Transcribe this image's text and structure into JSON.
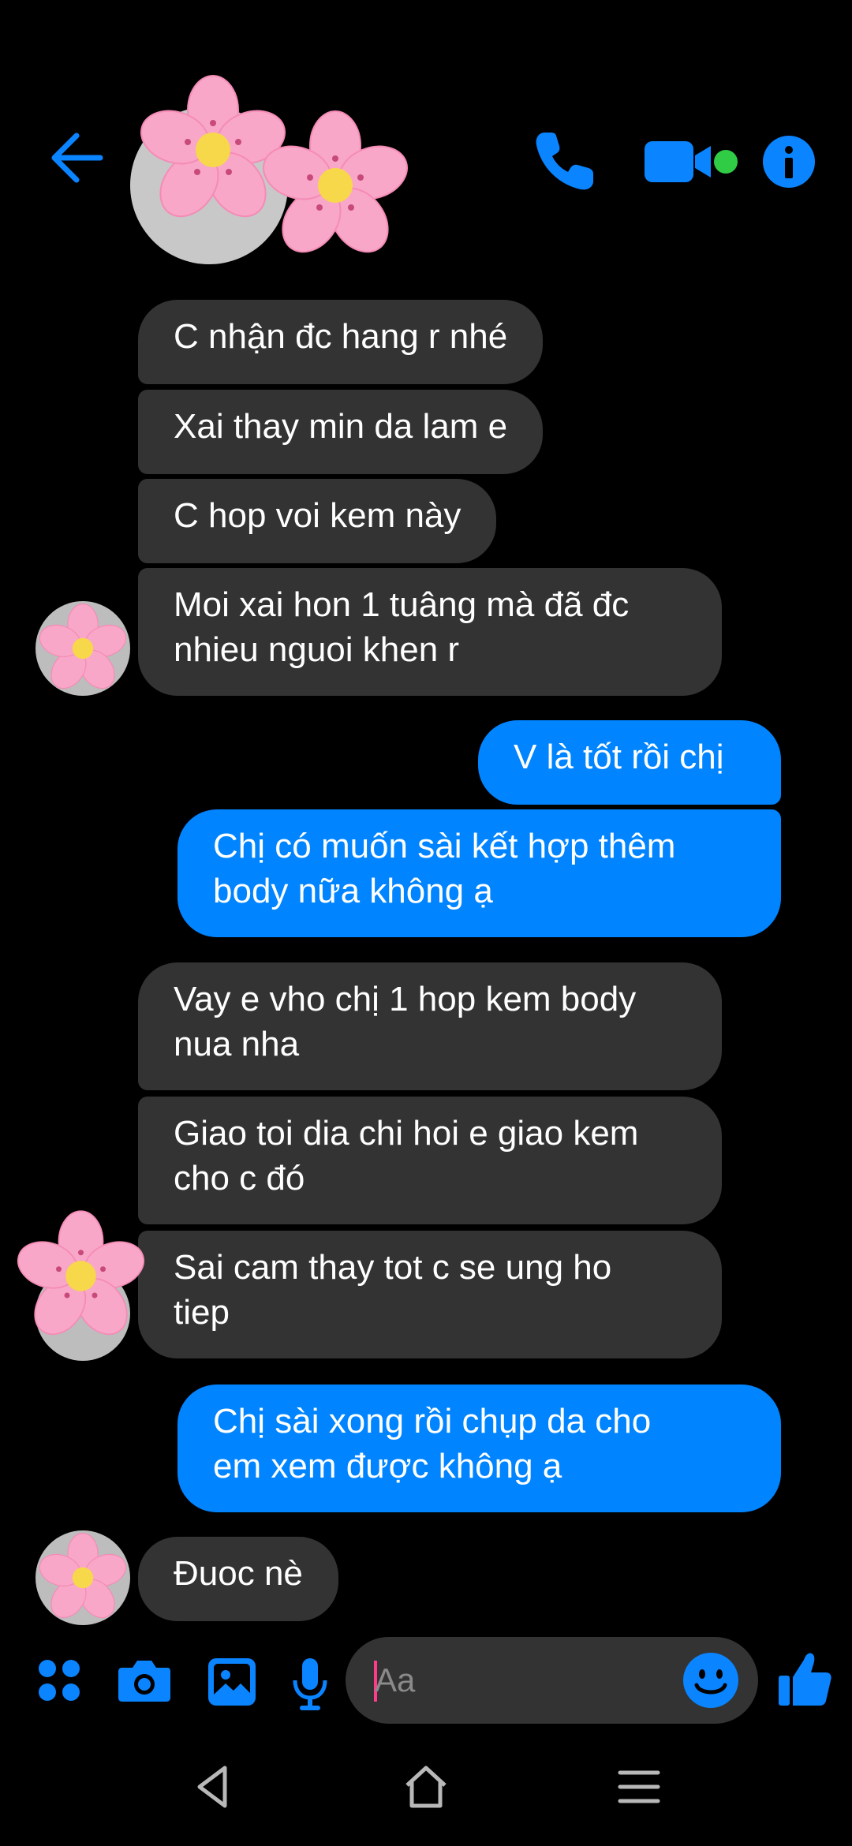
{
  "header": {
    "back_icon": "arrow-left-icon",
    "call_icon": "phone-icon",
    "video_icon": "video-camera-icon",
    "info_icon": "info-icon",
    "active_color": "#31cc46",
    "accent": "#0084ff"
  },
  "messages": [
    {
      "side": "in",
      "text": "C nhận đc hang r nhé"
    },
    {
      "side": "in",
      "text": "Xai thay min da lam e"
    },
    {
      "side": "in",
      "text": "C hop voi kem này"
    },
    {
      "side": "in",
      "text": "Moi xai hon 1 tuâng mà đã đc\nnhieu nguoi khen r"
    },
    {
      "side": "out",
      "text": "V là tốt rồi chị"
    },
    {
      "side": "out",
      "text": "Chị có muốn sài kết hợp thêm\nbody nữa không ạ"
    },
    {
      "side": "in",
      "text": "Vay e vho chị 1 hop kem body\nnua nha"
    },
    {
      "side": "in",
      "text": "Giao toi dia chi hoi e giao kem\ncho c đó"
    },
    {
      "side": "in",
      "text": "Sai cam thay tot c se ung ho\ntiep"
    },
    {
      "side": "out",
      "text": "Chị sài xong rồi chụp da cho\nem xem được không ạ"
    },
    {
      "side": "in",
      "text": "Đuoc nè"
    }
  ],
  "composer": {
    "placeholder": "Aa",
    "icons": [
      "apps-icon",
      "camera-icon",
      "gallery-icon",
      "microphone-icon",
      "emoji-icon",
      "thumbs-up-icon"
    ]
  },
  "navbar": {
    "icons": [
      "nav-back-icon",
      "nav-home-icon",
      "nav-menu-icon"
    ]
  }
}
